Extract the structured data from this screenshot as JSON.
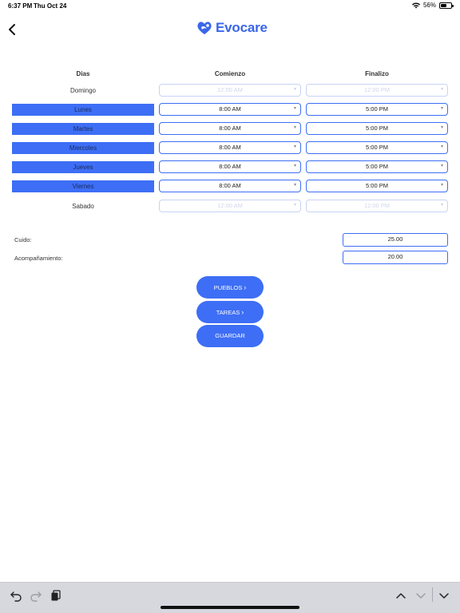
{
  "status_bar": {
    "time": "6:37 PM",
    "date": "Thu Oct 24",
    "battery": "56%",
    "battery_level": 0.56
  },
  "header": {
    "logo_text": "Evocare"
  },
  "schedule": {
    "headers": {
      "days": "Dias",
      "start": "Comienzo",
      "end": "Finalizo"
    },
    "rows": [
      {
        "day": "Domingo",
        "active": false,
        "start": "12:00 AM",
        "end": "12:00 PM"
      },
      {
        "day": "Lunes",
        "active": true,
        "start": "8:00 AM",
        "end": "5:00 PM"
      },
      {
        "day": "Martes",
        "active": true,
        "start": "8:00 AM",
        "end": "5:00 PM"
      },
      {
        "day": "Miercoles",
        "active": true,
        "start": "8:00 AM",
        "end": "5:00 PM"
      },
      {
        "day": "Jueves",
        "active": true,
        "start": "8:00 AM",
        "end": "5:00 PM"
      },
      {
        "day": "Viernes",
        "active": true,
        "start": "8:00 AM",
        "end": "5:00 PM"
      },
      {
        "day": "Sabado",
        "active": false,
        "start": "12:00 AM",
        "end": "12:00 PM"
      }
    ]
  },
  "rates": {
    "cuido_label": "Cuido:",
    "cuido_value": "25.00",
    "acomp_label": "Acompañamiento:",
    "acomp_value": "20.00"
  },
  "buttons": {
    "pueblos": "PUEBLOS",
    "tareas": "TAREAS",
    "guardar": "GUARDAR"
  },
  "colors": {
    "accent": "#3d6ef5",
    "brand": "#3a66ea"
  }
}
